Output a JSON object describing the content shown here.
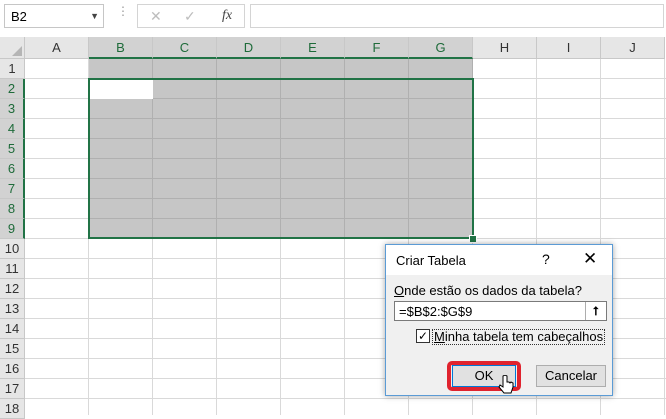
{
  "formula_bar": {
    "name_box": "B2",
    "icons": [
      "dropdown-arrow-icon",
      "cancel-icon",
      "enter-check-icon",
      "insert-function-icon"
    ],
    "fx_label": "fx",
    "formula": ""
  },
  "sheet": {
    "columns": [
      "A",
      "B",
      "C",
      "D",
      "E",
      "F",
      "G",
      "H",
      "I",
      "J"
    ],
    "rows": [
      "1",
      "2",
      "3",
      "4",
      "5",
      "6",
      "7",
      "8",
      "9",
      "10",
      "11",
      "12",
      "13",
      "14",
      "15",
      "16",
      "17",
      "18"
    ],
    "selected_range": "B2:G9",
    "active_cell": "B2",
    "accent_color": "#217346"
  },
  "dialog": {
    "title": "Criar Tabela",
    "help": "?",
    "close": "✕",
    "range_label_prefix": "O",
    "range_label_rest": "nde estão os dados da tabela?",
    "range_value": "=$B$2:$G$9",
    "collapse_icon": "collapse-dialog-icon",
    "checkbox_checked": true,
    "checkbox_label_prefix": "M",
    "checkbox_label_rest": "inha tabela tem cabeçalhos",
    "ok_label": "OK",
    "cancel_label": "Cancelar",
    "highlight_color": "#e0232e"
  }
}
